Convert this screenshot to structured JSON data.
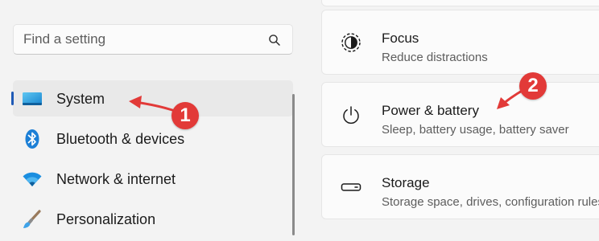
{
  "search": {
    "placeholder": "Find a setting",
    "icon": "search-icon"
  },
  "sidebar": {
    "items": [
      {
        "label": "System",
        "icon": "system-display-icon",
        "selected": true
      },
      {
        "label": "Bluetooth & devices",
        "icon": "bluetooth-icon",
        "selected": false
      },
      {
        "label": "Network & internet",
        "icon": "wifi-icon",
        "selected": false
      },
      {
        "label": "Personalization",
        "icon": "paintbrush-icon",
        "selected": false
      }
    ]
  },
  "cards": [
    {
      "title": "Focus",
      "subtitle": "Reduce distractions",
      "icon": "focus-icon"
    },
    {
      "title": "Power & battery",
      "subtitle": "Sleep, battery usage, battery saver",
      "icon": "power-icon"
    },
    {
      "title": "Storage",
      "subtitle": "Storage space, drives, configuration rules",
      "icon": "storage-icon"
    }
  ],
  "annotations": {
    "step1": "1",
    "step2": "2",
    "color": "#e23a38"
  },
  "colors": {
    "accent": "#1f5ab6",
    "background": "#f3f3f3",
    "card": "#fbfbfb"
  }
}
